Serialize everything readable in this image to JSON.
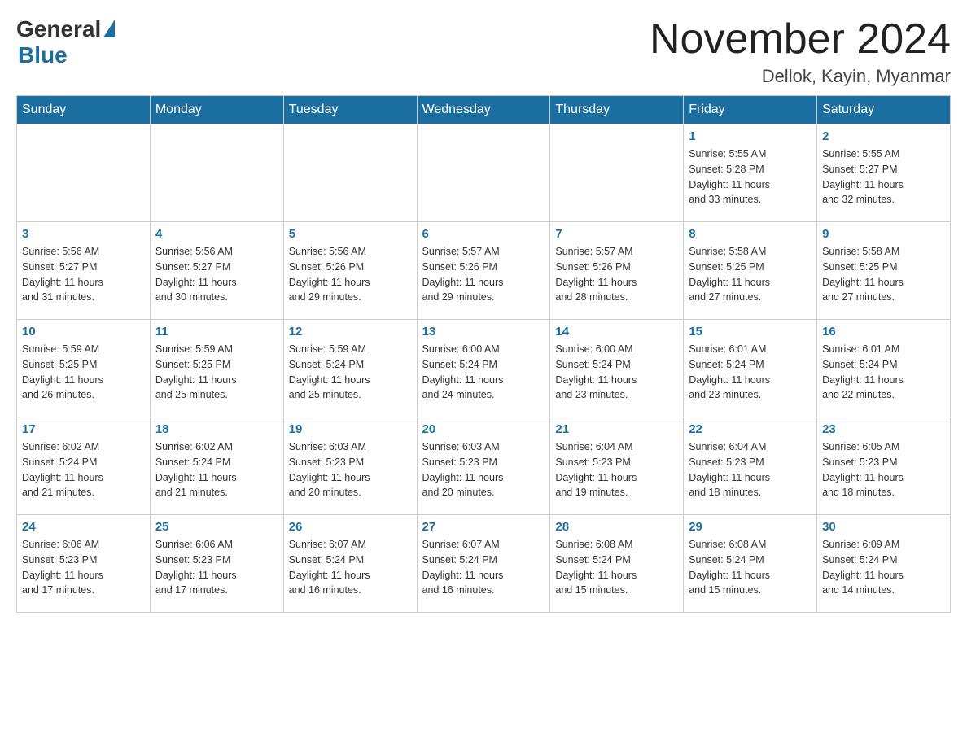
{
  "header": {
    "logo": {
      "general": "General",
      "blue": "Blue"
    },
    "title": "November 2024",
    "location": "Dellok, Kayin, Myanmar"
  },
  "days_of_week": [
    "Sunday",
    "Monday",
    "Tuesday",
    "Wednesday",
    "Thursday",
    "Friday",
    "Saturday"
  ],
  "weeks": [
    [
      {
        "day": "",
        "info": ""
      },
      {
        "day": "",
        "info": ""
      },
      {
        "day": "",
        "info": ""
      },
      {
        "day": "",
        "info": ""
      },
      {
        "day": "",
        "info": ""
      },
      {
        "day": "1",
        "info": "Sunrise: 5:55 AM\nSunset: 5:28 PM\nDaylight: 11 hours\nand 33 minutes."
      },
      {
        "day": "2",
        "info": "Sunrise: 5:55 AM\nSunset: 5:27 PM\nDaylight: 11 hours\nand 32 minutes."
      }
    ],
    [
      {
        "day": "3",
        "info": "Sunrise: 5:56 AM\nSunset: 5:27 PM\nDaylight: 11 hours\nand 31 minutes."
      },
      {
        "day": "4",
        "info": "Sunrise: 5:56 AM\nSunset: 5:27 PM\nDaylight: 11 hours\nand 30 minutes."
      },
      {
        "day": "5",
        "info": "Sunrise: 5:56 AM\nSunset: 5:26 PM\nDaylight: 11 hours\nand 29 minutes."
      },
      {
        "day": "6",
        "info": "Sunrise: 5:57 AM\nSunset: 5:26 PM\nDaylight: 11 hours\nand 29 minutes."
      },
      {
        "day": "7",
        "info": "Sunrise: 5:57 AM\nSunset: 5:26 PM\nDaylight: 11 hours\nand 28 minutes."
      },
      {
        "day": "8",
        "info": "Sunrise: 5:58 AM\nSunset: 5:25 PM\nDaylight: 11 hours\nand 27 minutes."
      },
      {
        "day": "9",
        "info": "Sunrise: 5:58 AM\nSunset: 5:25 PM\nDaylight: 11 hours\nand 27 minutes."
      }
    ],
    [
      {
        "day": "10",
        "info": "Sunrise: 5:59 AM\nSunset: 5:25 PM\nDaylight: 11 hours\nand 26 minutes."
      },
      {
        "day": "11",
        "info": "Sunrise: 5:59 AM\nSunset: 5:25 PM\nDaylight: 11 hours\nand 25 minutes."
      },
      {
        "day": "12",
        "info": "Sunrise: 5:59 AM\nSunset: 5:24 PM\nDaylight: 11 hours\nand 25 minutes."
      },
      {
        "day": "13",
        "info": "Sunrise: 6:00 AM\nSunset: 5:24 PM\nDaylight: 11 hours\nand 24 minutes."
      },
      {
        "day": "14",
        "info": "Sunrise: 6:00 AM\nSunset: 5:24 PM\nDaylight: 11 hours\nand 23 minutes."
      },
      {
        "day": "15",
        "info": "Sunrise: 6:01 AM\nSunset: 5:24 PM\nDaylight: 11 hours\nand 23 minutes."
      },
      {
        "day": "16",
        "info": "Sunrise: 6:01 AM\nSunset: 5:24 PM\nDaylight: 11 hours\nand 22 minutes."
      }
    ],
    [
      {
        "day": "17",
        "info": "Sunrise: 6:02 AM\nSunset: 5:24 PM\nDaylight: 11 hours\nand 21 minutes."
      },
      {
        "day": "18",
        "info": "Sunrise: 6:02 AM\nSunset: 5:24 PM\nDaylight: 11 hours\nand 21 minutes."
      },
      {
        "day": "19",
        "info": "Sunrise: 6:03 AM\nSunset: 5:23 PM\nDaylight: 11 hours\nand 20 minutes."
      },
      {
        "day": "20",
        "info": "Sunrise: 6:03 AM\nSunset: 5:23 PM\nDaylight: 11 hours\nand 20 minutes."
      },
      {
        "day": "21",
        "info": "Sunrise: 6:04 AM\nSunset: 5:23 PM\nDaylight: 11 hours\nand 19 minutes."
      },
      {
        "day": "22",
        "info": "Sunrise: 6:04 AM\nSunset: 5:23 PM\nDaylight: 11 hours\nand 18 minutes."
      },
      {
        "day": "23",
        "info": "Sunrise: 6:05 AM\nSunset: 5:23 PM\nDaylight: 11 hours\nand 18 minutes."
      }
    ],
    [
      {
        "day": "24",
        "info": "Sunrise: 6:06 AM\nSunset: 5:23 PM\nDaylight: 11 hours\nand 17 minutes."
      },
      {
        "day": "25",
        "info": "Sunrise: 6:06 AM\nSunset: 5:23 PM\nDaylight: 11 hours\nand 17 minutes."
      },
      {
        "day": "26",
        "info": "Sunrise: 6:07 AM\nSunset: 5:24 PM\nDaylight: 11 hours\nand 16 minutes."
      },
      {
        "day": "27",
        "info": "Sunrise: 6:07 AM\nSunset: 5:24 PM\nDaylight: 11 hours\nand 16 minutes."
      },
      {
        "day": "28",
        "info": "Sunrise: 6:08 AM\nSunset: 5:24 PM\nDaylight: 11 hours\nand 15 minutes."
      },
      {
        "day": "29",
        "info": "Sunrise: 6:08 AM\nSunset: 5:24 PM\nDaylight: 11 hours\nand 15 minutes."
      },
      {
        "day": "30",
        "info": "Sunrise: 6:09 AM\nSunset: 5:24 PM\nDaylight: 11 hours\nand 14 minutes."
      }
    ]
  ]
}
